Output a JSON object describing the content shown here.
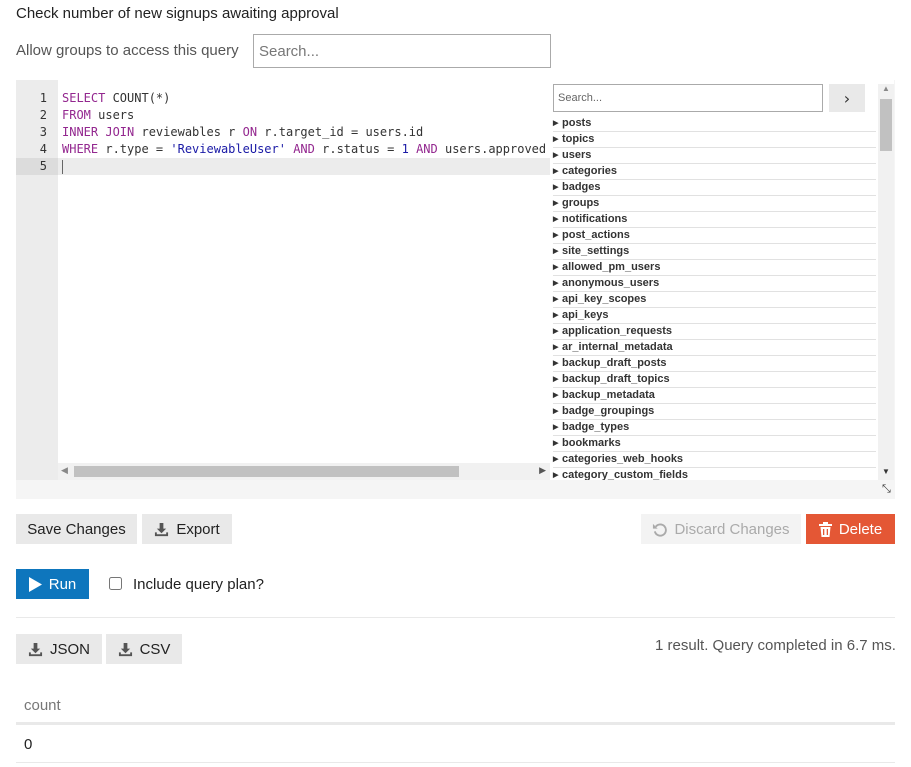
{
  "query": {
    "description": "Check number of new signups awaiting approval",
    "groups_label": "Allow groups to access this query",
    "groups_placeholder": "Search..."
  },
  "editor": {
    "line_numbers": [
      "1",
      "2",
      "3",
      "4",
      "5"
    ],
    "lines": [
      [
        {
          "t": "SELECT",
          "c": "kw"
        },
        {
          "t": " COUNT(*)",
          "c": ""
        }
      ],
      [
        {
          "t": "FROM",
          "c": "kw"
        },
        {
          "t": " users",
          "c": ""
        }
      ],
      [
        {
          "t": "INNER JOIN",
          "c": "kw"
        },
        {
          "t": " reviewables r ",
          "c": ""
        },
        {
          "t": "ON",
          "c": "kw"
        },
        {
          "t": " r.target_id = users.id",
          "c": ""
        }
      ],
      [
        {
          "t": "WHERE",
          "c": "kw"
        },
        {
          "t": " r.type = ",
          "c": ""
        },
        {
          "t": "'ReviewableUser'",
          "c": "str"
        },
        {
          "t": " ",
          "c": ""
        },
        {
          "t": "AND",
          "c": "kw"
        },
        {
          "t": " r.status = ",
          "c": ""
        },
        {
          "t": "1",
          "c": "num"
        },
        {
          "t": " ",
          "c": ""
        },
        {
          "t": "AND",
          "c": "kw"
        },
        {
          "t": " users.approved",
          "c": ""
        }
      ],
      []
    ],
    "active_line": 5
  },
  "schema": {
    "search_placeholder": "Search...",
    "go_icon": "chevron-right-icon",
    "tables": [
      "posts",
      "topics",
      "users",
      "categories",
      "badges",
      "groups",
      "notifications",
      "post_actions",
      "site_settings",
      "allowed_pm_users",
      "anonymous_users",
      "api_key_scopes",
      "api_keys",
      "application_requests",
      "ar_internal_metadata",
      "backup_draft_posts",
      "backup_draft_topics",
      "backup_metadata",
      "badge_groupings",
      "badge_types",
      "bookmarks",
      "categories_web_hooks",
      "category_custom_fields"
    ]
  },
  "actions": {
    "save_label": "Save Changes",
    "export_label": "Export",
    "discard_label": "Discard Changes",
    "delete_label": "Delete",
    "run_label": "Run",
    "include_plan_label": "Include query plan?",
    "include_plan_checked": false
  },
  "results": {
    "json_label": "JSON",
    "csv_label": "CSV",
    "summary": "1 result. Query completed in 6.7 ms.",
    "columns": [
      "count"
    ],
    "rows": [
      [
        "0"
      ]
    ]
  },
  "colors": {
    "run_button": "#0e76bd",
    "delete_button": "#e45735",
    "keyword": "#93278f",
    "string_literal": "#1a1aa6"
  }
}
